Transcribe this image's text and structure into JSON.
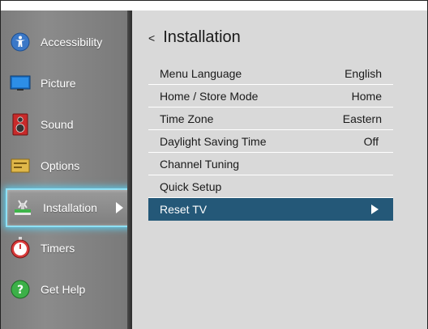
{
  "sidebar": {
    "items": [
      {
        "label": "Accessibility",
        "icon": "accessibility-icon"
      },
      {
        "label": "Picture",
        "icon": "picture-icon"
      },
      {
        "label": "Sound",
        "icon": "sound-icon"
      },
      {
        "label": "Options",
        "icon": "options-icon"
      },
      {
        "label": "Installation",
        "icon": "installation-icon",
        "selected": true
      },
      {
        "label": "Timers",
        "icon": "timers-icon"
      },
      {
        "label": "Get Help",
        "icon": "help-icon"
      }
    ]
  },
  "main": {
    "back_symbol": "<",
    "title": "Installation",
    "rows": [
      {
        "label": "Menu Language",
        "value": "English"
      },
      {
        "label": "Home / Store Mode",
        "value": "Home"
      },
      {
        "label": "Time Zone",
        "value": "Eastern"
      },
      {
        "label": "Daylight Saving Time",
        "value": "Off"
      },
      {
        "label": "Channel Tuning",
        "value": ""
      },
      {
        "label": "Quick Setup",
        "value": ""
      },
      {
        "label": "Reset TV",
        "value": "",
        "highlighted": true
      }
    ]
  },
  "colors": {
    "highlight": "#245878",
    "selection_glow": "#5cc9e8",
    "panel": "#d9d9d9",
    "sidebar": "#858585"
  }
}
